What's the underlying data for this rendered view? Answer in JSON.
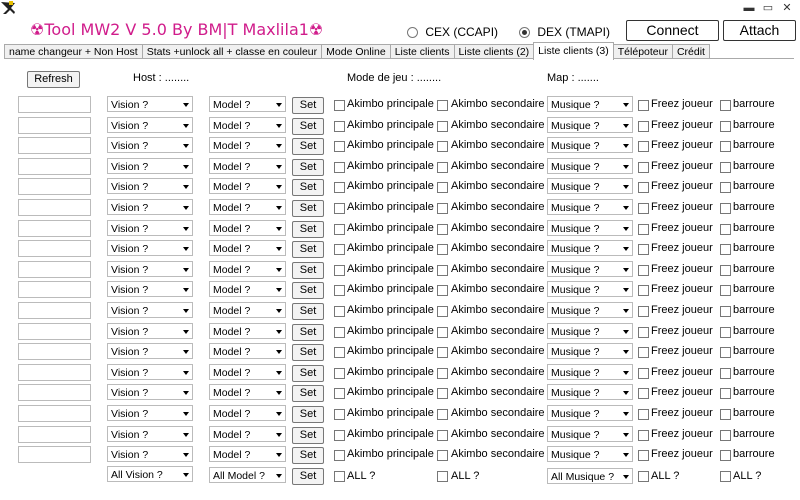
{
  "app": {
    "title": "☢Tool MW2 V 5.0  By BM|T Maxlila1☢",
    "accent_color": "#d01c8b"
  },
  "window_controls": [
    "minimize-icon",
    "maximize-icon",
    "close-icon"
  ],
  "connection": {
    "cex_label": "CEX (CCAPI)",
    "dex_label": "DEX (TMAPI)",
    "selected": "DEX (TMAPI)",
    "connect_label": "Connect",
    "attach_label": "Attach"
  },
  "tabs": [
    {
      "label": "name changeur + Non Host"
    },
    {
      "label": "Stats +unlock all + classe en couleur"
    },
    {
      "label": "Mode Online"
    },
    {
      "label": "Liste clients"
    },
    {
      "label": "Liste clients (2)"
    },
    {
      "label": "Liste clients (3)",
      "active": true
    },
    {
      "label": "Télépoteur"
    },
    {
      "label": "Crédit"
    }
  ],
  "header": {
    "refresh_label": "Refresh",
    "host_label": "Host :  ........",
    "mode_label": "Mode de jeu :  ........",
    "map_label": "Map :  ......."
  },
  "row": {
    "vision_value": "Vision ?",
    "model_value": "Model  ?",
    "set_label": "Set",
    "akimbo_principale": "Akimbo principale",
    "akimbo_secondaire": "Akimbo secondaire",
    "musique_value": "Musique  ?",
    "freez_label": "Freez joueur",
    "barroure_label": "barroure"
  },
  "row_count": 18,
  "footer": {
    "all_vision": "All Vision ?",
    "all_model": "All Model  ?",
    "set_label": "Set",
    "all_label": "ALL ?",
    "all_musique": "All Musique  ?"
  }
}
